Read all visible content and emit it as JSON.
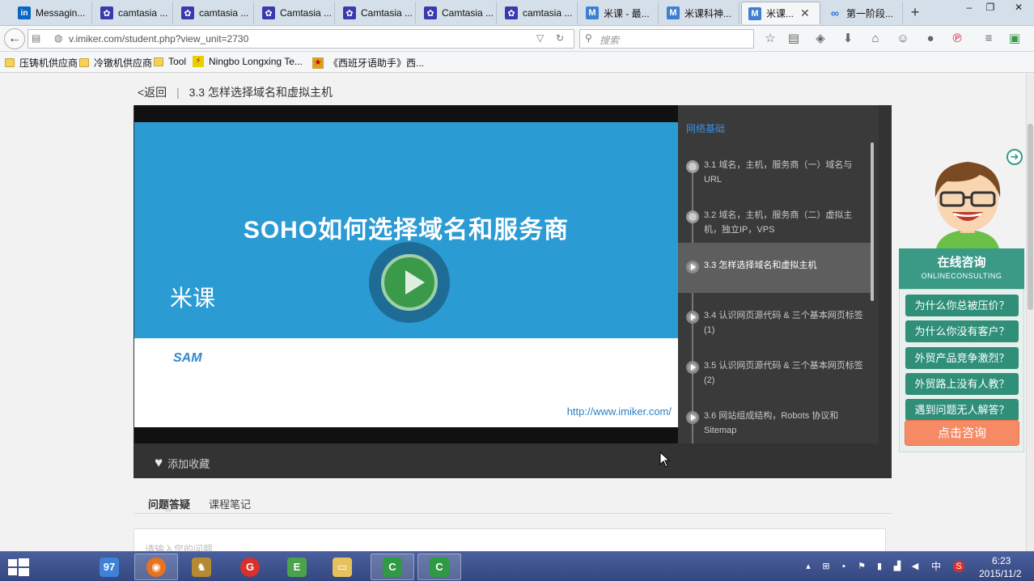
{
  "browser": {
    "tabs": [
      {
        "icon": "linkedin-icon",
        "label": "Messagin..."
      },
      {
        "icon": "paw-icon",
        "label": "camtasia ..."
      },
      {
        "icon": "paw-icon",
        "label": "camtasia ..."
      },
      {
        "icon": "paw-icon",
        "label": "Camtasia ..."
      },
      {
        "icon": "paw-icon",
        "label": "Camtasia ..."
      },
      {
        "icon": "paw-icon",
        "label": "Camtasia ..."
      },
      {
        "icon": "paw-icon",
        "label": "camtasia ..."
      },
      {
        "icon": "m-icon",
        "label": "米课 - 最..."
      },
      {
        "icon": "m-icon",
        "label": "米课科神..."
      },
      {
        "icon": "m-icon",
        "label": "米课..."
      },
      {
        "icon": "link-icon",
        "label": "第一阶段..."
      }
    ],
    "url": "v.imiker.com/student.php?view_unit=2730",
    "search_placeholder": "搜索",
    "bookmarks": [
      "压铸机供应商",
      "冷镦机供应商",
      "Tool",
      "Ningbo Longxing Te...",
      "《西班牙语助手》西..."
    ]
  },
  "page": {
    "back_label": "<返回",
    "separator": "|",
    "lesson_title": "3.3  怎样选择域名和虚拟主机",
    "video": {
      "slide_title": "SOHO如何选择域名和服务商",
      "brand": "米课",
      "logo": "SAM",
      "url": "http://www.imiker.com/"
    },
    "favorite_label": "添加收藏",
    "playlist": {
      "section": "网络基础",
      "lessons": [
        {
          "text": "3.1 域名，主机，服务商（一）域名与URL"
        },
        {
          "text": "3.2 域名，主机，服务商（二）虚拟主机，独立IP，VPS"
        },
        {
          "text": "3.3 怎样选择域名和虚拟主机"
        },
        {
          "text": "3.4 认识网页源代码 & 三个基本网页标签(1)"
        },
        {
          "text": "3.5 认识网页源代码 & 三个基本网页标签(2)"
        },
        {
          "text": "3.6 网站组成结构，Robots 协议和 Sitemap"
        }
      ]
    },
    "tabs": [
      "问题答疑",
      "课程笔记"
    ],
    "question_placeholder": "请输入您的问题"
  },
  "consult": {
    "title": "在线咨询",
    "subtitle": "ONLINECONSULTING",
    "questions": [
      "为什么你总被压价？",
      "为什么你没有客户？",
      "外贸产品竞争激烈？",
      "外贸路上没有人教？",
      "遇到问题无人解答？"
    ],
    "cta": "点击咨询"
  },
  "taskbar": {
    "time": "6:23",
    "date": "2015/11/2",
    "ime": "中"
  },
  "colors": {
    "slide_blue": "#2b9bd3",
    "consult_green": "#3a9a86",
    "cta_orange": "#f58a64",
    "playlist_link": "#3a8fdc"
  }
}
